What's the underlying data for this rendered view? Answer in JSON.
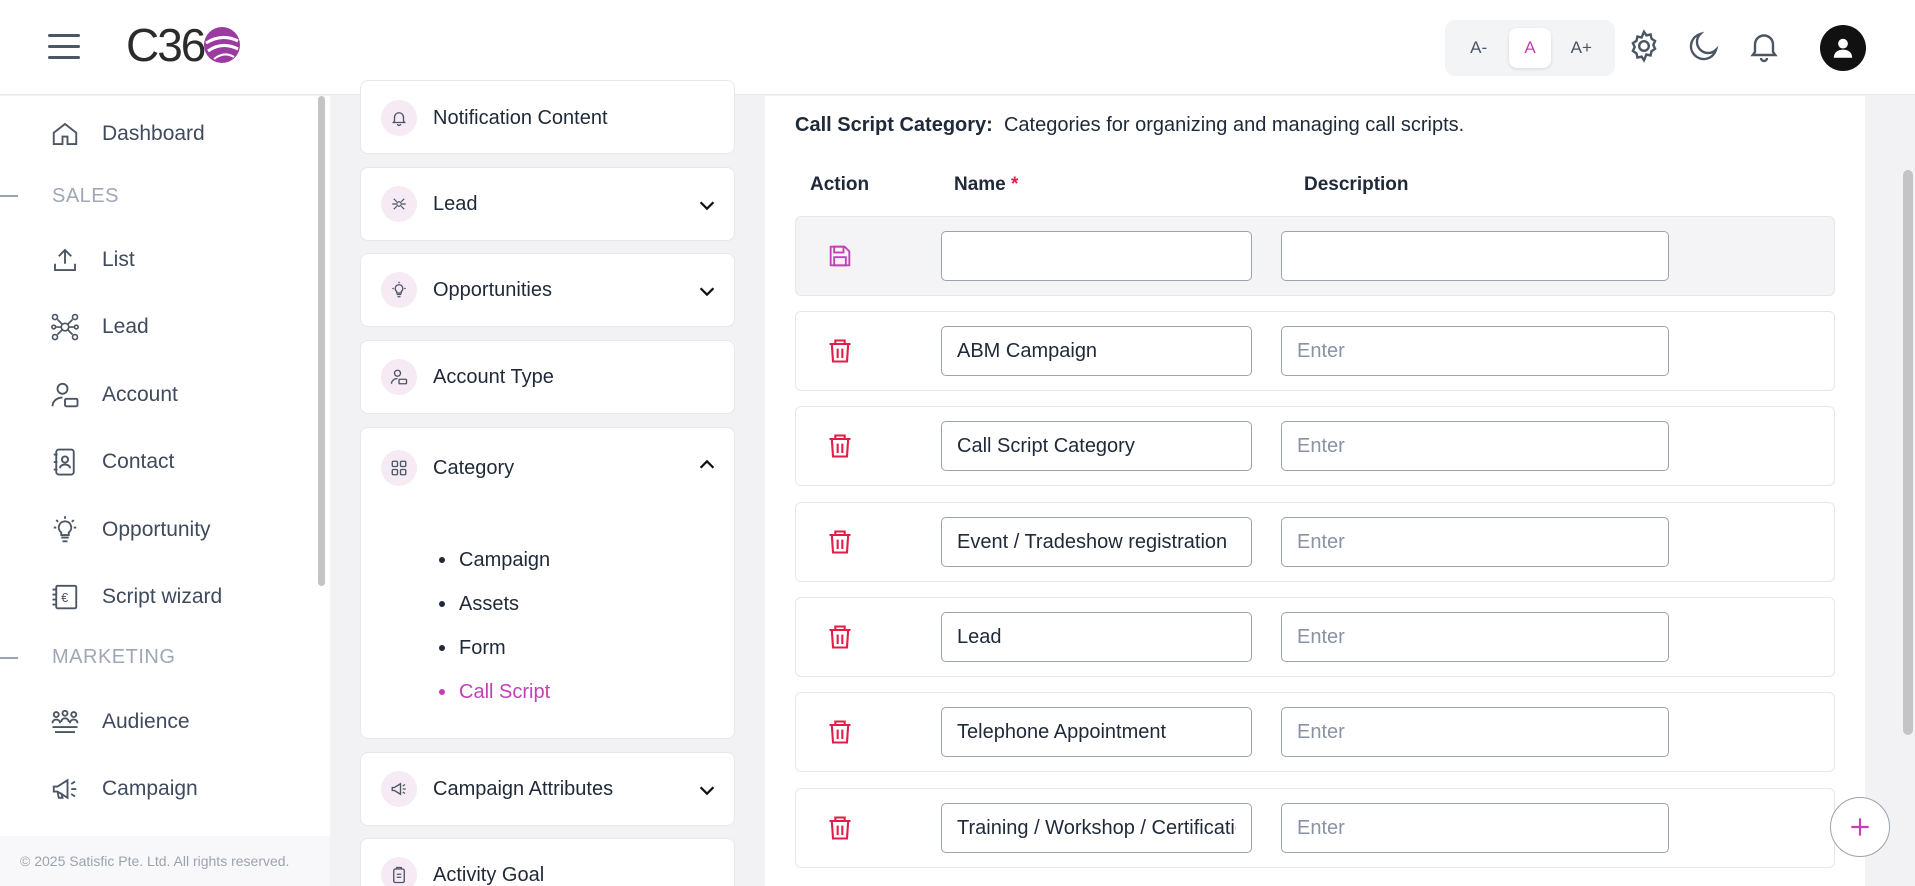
{
  "header": {
    "logo_text": "C36",
    "font_decrease": "A-",
    "font_default": "A",
    "font_increase": "A+"
  },
  "sidebar": {
    "items": [
      {
        "label": "Dashboard",
        "icon": "home-icon"
      },
      {
        "label": "List",
        "icon": "upload-icon"
      },
      {
        "label": "Lead",
        "icon": "network-icon"
      },
      {
        "label": "Account",
        "icon": "account-icon"
      },
      {
        "label": "Contact",
        "icon": "contact-book-icon"
      },
      {
        "label": "Opportunity",
        "icon": "lightbulb-icon"
      },
      {
        "label": "Script wizard",
        "icon": "script-icon"
      },
      {
        "label": "Audience",
        "icon": "audience-icon"
      },
      {
        "label": "Campaign",
        "icon": "megaphone-icon"
      }
    ],
    "sections": {
      "sales": "SALES",
      "marketing": "MARKETING"
    }
  },
  "footer": {
    "copyright": "© 2025 Satisfic Pte. Ltd. All rights reserved."
  },
  "settings_panel": {
    "notification_content": "Notification Content",
    "lead": "Lead",
    "opportunities": "Opportunities",
    "account_type": "Account Type",
    "category": "Category",
    "category_items": [
      "Campaign",
      "Assets",
      "Form",
      "Call Script"
    ],
    "category_active": "Call Script",
    "campaign_attributes": "Campaign Attributes",
    "activity_goal": "Activity Goal"
  },
  "main": {
    "title_label": "Call Script Category:",
    "title_desc": "Categories for organizing and managing call scripts.",
    "columns": {
      "action": "Action",
      "name": "Name",
      "required_mark": "*",
      "description": "Description"
    },
    "description_placeholder": "Enter",
    "rows": [
      {
        "name": "ABM Campaign",
        "description": ""
      },
      {
        "name": "Call Script Category",
        "description": ""
      },
      {
        "name": "Event / Tradeshow registration",
        "description": ""
      },
      {
        "name": "Lead",
        "description": ""
      },
      {
        "name": "Telephone Appointment",
        "description": ""
      },
      {
        "name": "Training / Workshop / Certification",
        "description": ""
      }
    ]
  },
  "colors": {
    "accent": "#c340b5",
    "danger": "#e11d48"
  }
}
